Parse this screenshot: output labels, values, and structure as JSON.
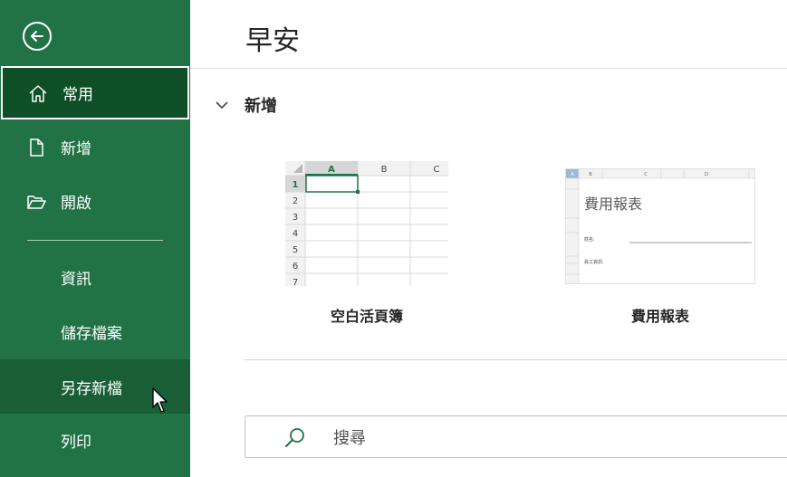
{
  "sidebar": {
    "items": [
      {
        "label": "常用",
        "icon": "home-icon"
      },
      {
        "label": "新增",
        "icon": "new-file-icon"
      },
      {
        "label": "開啟",
        "icon": "folder-open-icon"
      },
      {
        "label": "資訊"
      },
      {
        "label": "儲存檔案"
      },
      {
        "label": "另存新檔"
      },
      {
        "label": "列印"
      }
    ],
    "selected": "常用",
    "hovered": "另存新檔"
  },
  "main": {
    "greeting": "早安",
    "section_title": "新增",
    "templates": [
      {
        "name": "空白活頁簿",
        "columns": [
          "A",
          "B",
          "C"
        ],
        "rows": [
          "1",
          "2",
          "3",
          "4",
          "5",
          "6",
          "7"
        ]
      },
      {
        "name": "費用報表",
        "preview_title": "費用報表",
        "preview_columns": [
          "A",
          "B",
          "C",
          "D"
        ],
        "preview_fields": [
          "姓名:",
          "員工資訊:"
        ]
      }
    ],
    "search": {
      "placeholder": "搜尋"
    }
  },
  "colors": {
    "accent": "#217346",
    "selected_bg": "#0e4f27",
    "hover_bg": "#1a5e37"
  }
}
